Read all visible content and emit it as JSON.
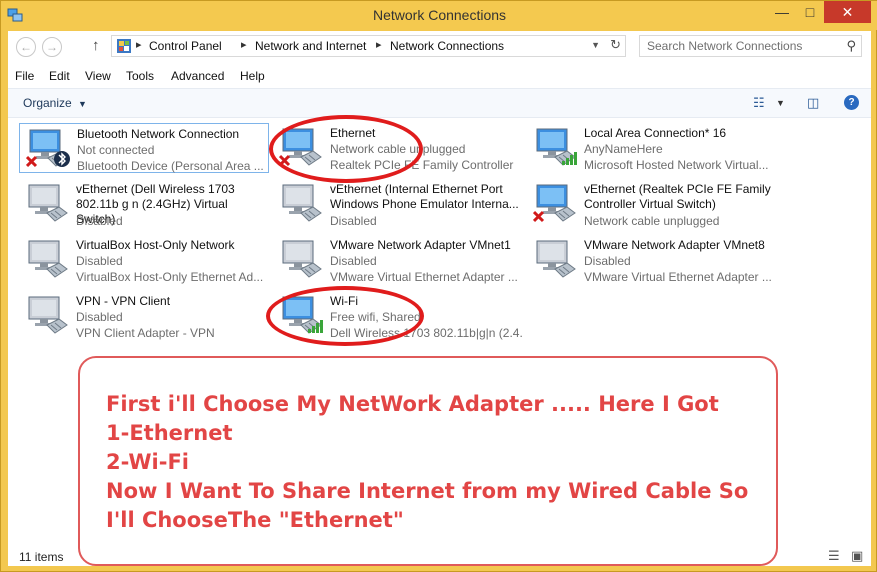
{
  "window": {
    "title": "Network Connections"
  },
  "address": {
    "crumbs": [
      "Control Panel",
      "Network and Internet",
      "Network Connections"
    ],
    "search_placeholder": "Search Network Connections"
  },
  "menu": [
    "File",
    "Edit",
    "View",
    "Tools",
    "Advanced",
    "Help"
  ],
  "toolbar": {
    "organize": "Organize"
  },
  "connections": [
    {
      "name": "Bluetooth Network Connection",
      "status": "Not connected",
      "device": "Bluetooth Device (Personal Area ...",
      "badge": "x",
      "extra": "bluetooth"
    },
    {
      "name": "Ethernet",
      "status": "Network cable unplugged",
      "device": "Realtek PCIe FE Family Controller",
      "badge": "x"
    },
    {
      "name": "Local Area Connection* 16",
      "status": "AnyNameHere",
      "device": "Microsoft Hosted Network Virtual...",
      "badge": "signal"
    },
    {
      "name": "vEthernet (Dell Wireless 1703 802.11b g n (2.4GHz) Virtual Switch)",
      "status": "Disabled",
      "device": "",
      "badge": "none"
    },
    {
      "name": "vEthernet (Internal Ethernet Port Windows Phone Emulator Interna...",
      "status": "Disabled",
      "device": "",
      "badge": "none"
    },
    {
      "name": "vEthernet (Realtek PCIe FE Family Controller Virtual Switch)",
      "status": "Network cable unplugged",
      "device": "",
      "badge": "x"
    },
    {
      "name": "VirtualBox Host-Only Network",
      "status": "Disabled",
      "device": "VirtualBox Host-Only Ethernet Ad...",
      "badge": "none"
    },
    {
      "name": "VMware Network Adapter VMnet1",
      "status": "Disabled",
      "device": "VMware Virtual Ethernet Adapter ...",
      "badge": "none"
    },
    {
      "name": "VMware Network Adapter VMnet8",
      "status": "Disabled",
      "device": "VMware Virtual Ethernet Adapter ...",
      "badge": "none"
    },
    {
      "name": "VPN - VPN Client",
      "status": "Disabled",
      "device": "VPN Client Adapter - VPN",
      "badge": "none"
    },
    {
      "name": "Wi-Fi",
      "status": "Free wifi, Shared",
      "device": "Dell Wireless 1703 802.11b|g|n (2.4...",
      "badge": "signal"
    }
  ],
  "statusbar": {
    "count": "11 items"
  },
  "annotation": {
    "lines": [
      "First i'll Choose My NetWork Adapter ..... Here I Got",
      "1-Ethernet",
      "2-Wi-Fi",
      "Now I Want To Share Internet from my Wired Cable So",
      "I'll ChooseThe \"Ethernet\""
    ]
  },
  "colors": {
    "titlebar": "#f4c94f",
    "close": "#c7392a",
    "annotation": "#e24545",
    "ring": "#e01c1c"
  }
}
